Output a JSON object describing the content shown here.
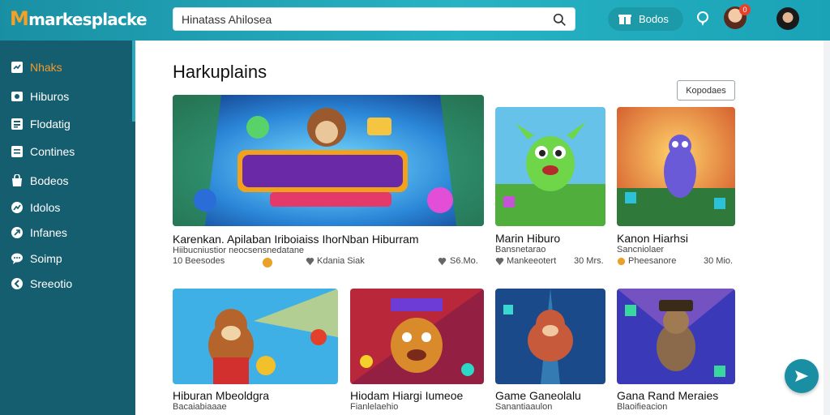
{
  "app": {
    "logo_m": "M",
    "logo_rest": "markesplacke"
  },
  "search": {
    "value": "Hinatass Ahilosea"
  },
  "header": {
    "promo_label": "Bodos",
    "notification_count": "0"
  },
  "sidebar": {
    "items": [
      {
        "label": "Nhaks",
        "icon": "dashboard-icon"
      },
      {
        "label": "Hiburos",
        "icon": "image-icon"
      },
      {
        "label": "Flodatig",
        "icon": "list-icon"
      },
      {
        "label": "Contines",
        "icon": "file-icon"
      },
      {
        "label": "Bodeos",
        "icon": "bag-icon"
      },
      {
        "label": "Idolos",
        "icon": "chart-icon"
      },
      {
        "label": "Infanes",
        "icon": "send-icon"
      },
      {
        "label": "Soimp",
        "icon": "chat-icon"
      },
      {
        "label": "Sreeotio",
        "icon": "settings-icon"
      }
    ]
  },
  "main": {
    "title": "Harkuplains",
    "filter_label": "Kopodaes"
  },
  "cards": [
    {
      "title": "Karenkan. Apilaban Iriboiaiss IhorNban Hiburram",
      "subtitle": "Hiibucniustior neocsensnedatane",
      "meta_left": "10 Beesodes",
      "meta_mid": "Kdania Siak",
      "price": "S6.Mo."
    },
    {
      "title": "Marin Hiburo",
      "subtitle": "Bansnetarao",
      "meta_left": "Mankeeotert",
      "price": "30 Mrs."
    },
    {
      "title": "Kanon Hiarhsi",
      "subtitle": "Sancniolaer",
      "meta_left": "Pheesanore",
      "price": "30 Mio."
    },
    {
      "title": "Hiburan Mbeoldgra",
      "subtitle": "Bacaiabiaaae"
    },
    {
      "title": "Hiodam Hiargi Iumeoe",
      "subtitle": "Fianlelaehio"
    },
    {
      "title": "Game Ganeolalu",
      "subtitle": "Sanantiaaulon"
    },
    {
      "title": "Gana Rand Meraies",
      "subtitle": "Blaoifieacion"
    }
  ],
  "colors": {
    "accent": "#f59a2e",
    "sidebar": "#155e6f",
    "topbar": "#1a8fa3"
  }
}
